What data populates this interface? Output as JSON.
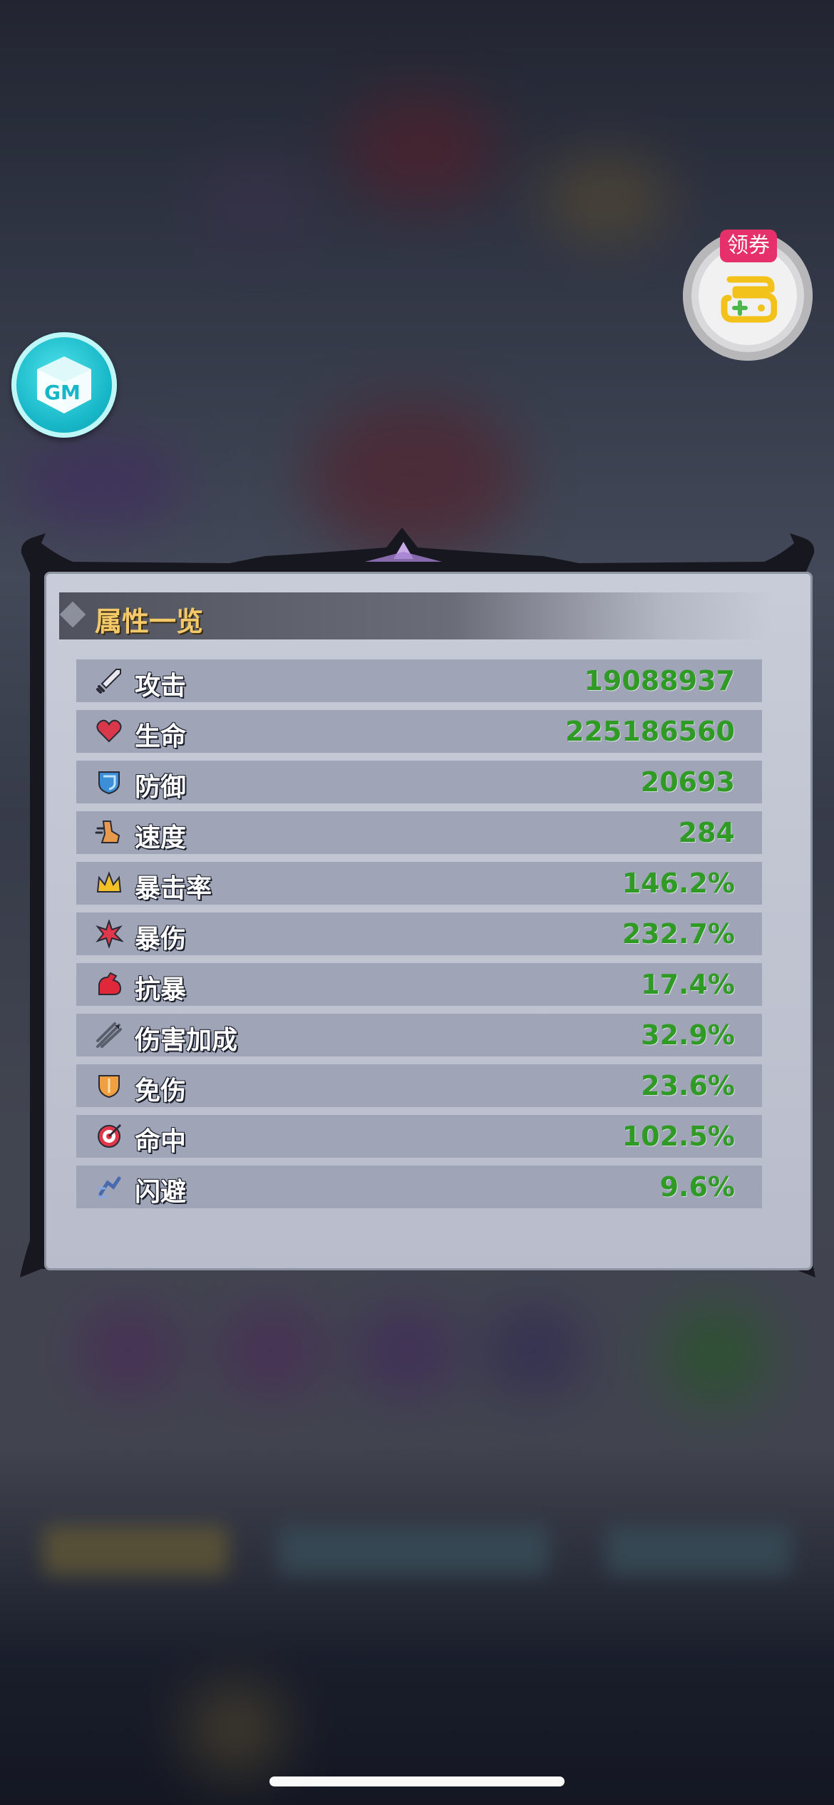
{
  "panel": {
    "title": "属性一览"
  },
  "stats": [
    {
      "label": "攻击",
      "value": "19088937",
      "icon": "sword-icon"
    },
    {
      "label": "生命",
      "value": "225186560",
      "icon": "heart-icon"
    },
    {
      "label": "防御",
      "value": "20693",
      "icon": "shield-icon"
    },
    {
      "label": "速度",
      "value": "284",
      "icon": "boot-icon"
    },
    {
      "label": "暴击率",
      "value": "146.2%",
      "icon": "crown-icon"
    },
    {
      "label": "暴伤",
      "value": "232.7%",
      "icon": "burst-icon"
    },
    {
      "label": "抗暴",
      "value": "17.4%",
      "icon": "muscle-icon"
    },
    {
      "label": "伤害加成",
      "value": "32.9%",
      "icon": "arrows-icon"
    },
    {
      "label": "免伤",
      "value": "23.6%",
      "icon": "guard-icon"
    },
    {
      "label": "命中",
      "value": "102.5%",
      "icon": "target-icon"
    },
    {
      "label": "闪避",
      "value": "9.6%",
      "icon": "dodge-icon"
    }
  ],
  "coupon": {
    "tag": "领券"
  },
  "colors": {
    "stat_value": "#2f9b25",
    "title": "#f3c96a",
    "gm_button": "#17b7c8",
    "coupon_tag": "#e6306b"
  }
}
